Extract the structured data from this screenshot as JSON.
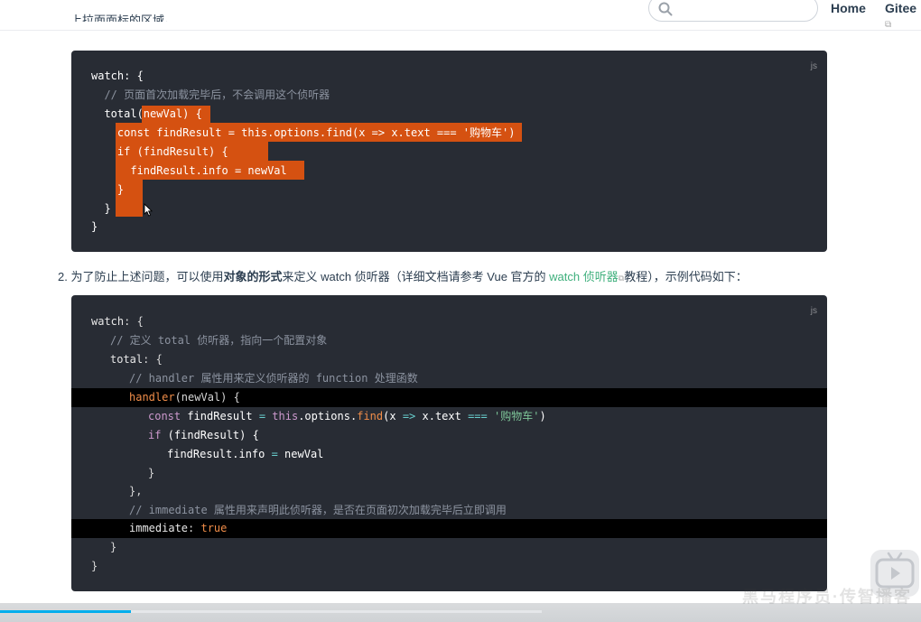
{
  "header": {
    "cut_text": "上拉面面标的区域。",
    "search_placeholder": "",
    "nav": {
      "home": "Home",
      "gitee": "Gitee",
      "gitee_ext": "⧉"
    }
  },
  "code_block_1": {
    "lang": "js",
    "lines": [
      "watch: {",
      "  // 页面首次加载完毕后，不会调用这个侦听器",
      "  total(newVal) {",
      "    const findResult = this.options.find(x => x.text === '购物车')",
      "    if (findResult) {",
      "      findResult.info = newVal",
      "    }",
      "  }",
      "}"
    ]
  },
  "paragraph": {
    "number": "2.",
    "text_1": "为了防止上述问题，可以使用",
    "bold": "对象的形式",
    "text_2": "来定义 watch 侦听器（详细文档请参考 Vue 官方的 ",
    "link": "watch 侦听器",
    "link_ext": "⧉",
    "text_3": "教程），示例代码如下："
  },
  "code_block_2": {
    "lang": "js",
    "l1_key": "watch",
    "l1_rest": ": {",
    "l2": "// 定义 total 侦听器，指向一个配置对象",
    "l3_key": "total",
    "l3_rest": ": {",
    "l4": "// handler 属性用来定义侦听器的 function 处理函数",
    "l5_fn": "handler",
    "l5_rest": "(newVal) {",
    "l6_kw": "const",
    "l6_a": " findResult ",
    "l6_eq": "=",
    "l6_this": " this",
    "l6_b": ".options.",
    "l6_find": "find",
    "l6_c": "(x ",
    "l6_arrow": "=>",
    "l6_d": " x.text ",
    "l6_eqq": "===",
    "l6_str": " '购物车'",
    "l6_e": ")",
    "l7_kw": "if",
    "l7_rest": " (findResult) {",
    "l8_a": "findResult.info ",
    "l8_eq": "=",
    "l8_b": " newVal",
    "l9": "}",
    "l10": "},",
    "l11": "// immediate 属性用来声明此侦听器，是否在页面初次加载完毕后立即调用",
    "l12_key": "immediate",
    "l12_colon": ": ",
    "l12_val": "true",
    "l13": "}",
    "l14": "}"
  },
  "player": {
    "progress_fraction": 0.242,
    "watermark": "黑马程序员·传智播客"
  }
}
